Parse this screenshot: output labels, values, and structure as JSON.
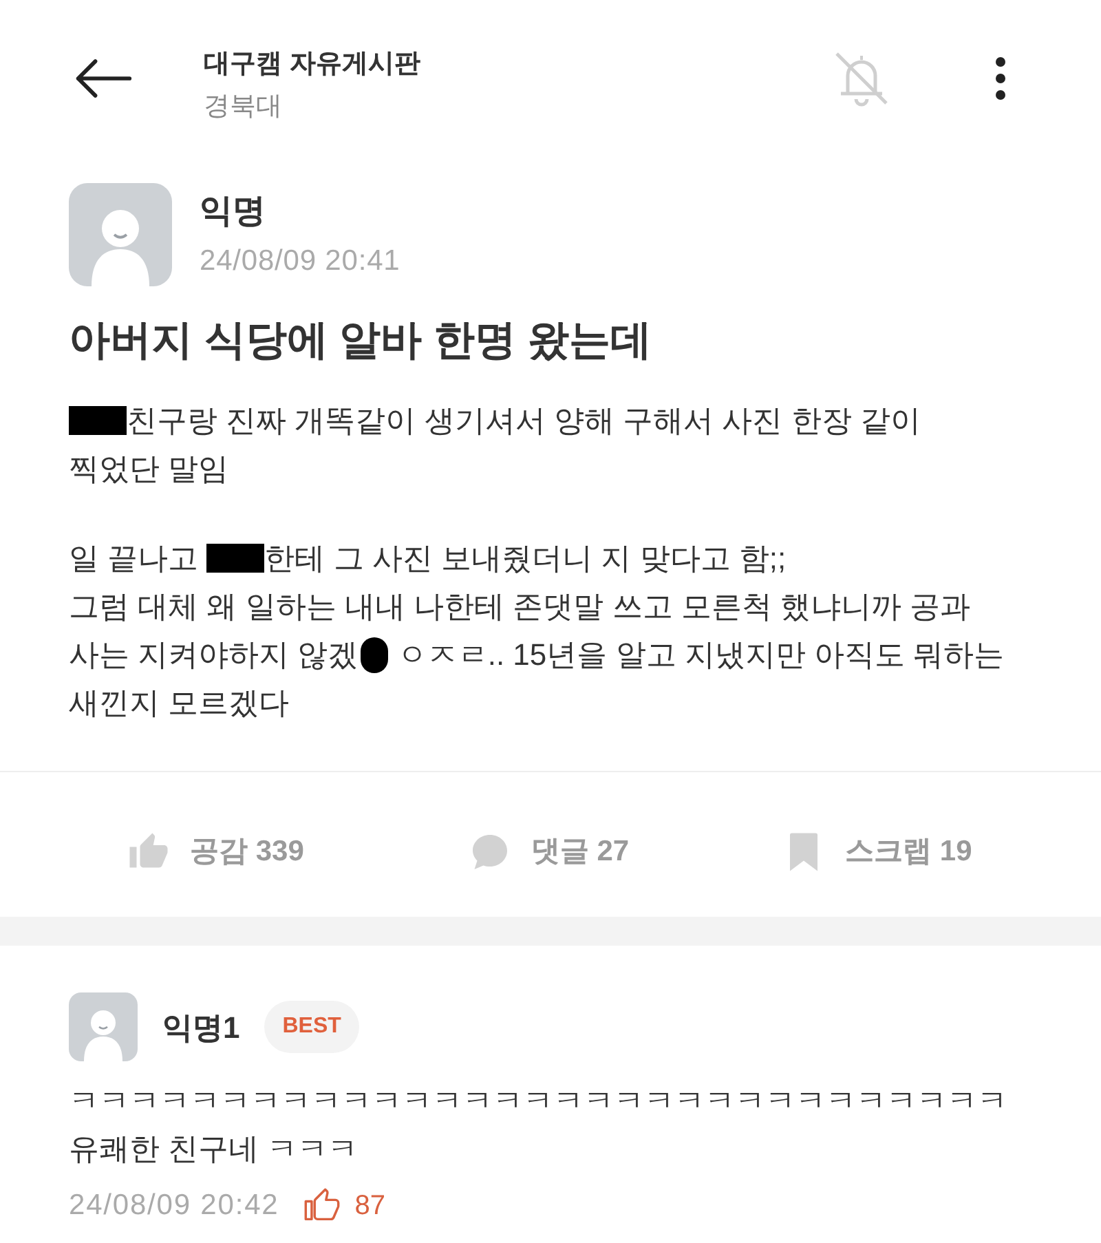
{
  "header": {
    "title": "대구캠 자유게시판",
    "subtitle": "경북대",
    "notifications_muted": true
  },
  "post": {
    "author": "익명",
    "time": "24/08/09 20:41",
    "title": "아버지 식당에 알바 한명 왔는데",
    "paragraphs": [
      {
        "lines": [
          {
            "segments": [
              {
                "kind": "redaction"
              },
              {
                "kind": "text",
                "text": "친구랑 진짜 개똑같이 생기셔서 양해 구해서 사진 한장 같이"
              }
            ]
          },
          {
            "segments": [
              {
                "kind": "text",
                "text": "찍었단 말임"
              }
            ]
          }
        ]
      },
      {
        "lines": [
          {
            "segments": [
              {
                "kind": "text",
                "text": "일 끝나고 "
              },
              {
                "kind": "redaction"
              },
              {
                "kind": "text",
                "text": "한테 그 사진 보내줬더니 지 맞다고 함;;"
              }
            ]
          },
          {
            "segments": [
              {
                "kind": "text",
                "text": "그럼 대체 왜 일하는 내내 나한테 존댓말 쓰고 모른척 했냐니까 공과"
              }
            ]
          },
          {
            "segments": [
              {
                "kind": "text",
                "text": "사는 지켜야하지 않겠"
              },
              {
                "kind": "smudge"
              },
              {
                "kind": "text",
                "text": " ㅇㅈㄹ.. 15년을 알고 지냈지만 아직도 뭐하는"
              }
            ]
          },
          {
            "segments": [
              {
                "kind": "text",
                "text": "새낀지 모르겠다"
              }
            ]
          }
        ]
      }
    ]
  },
  "actions": [
    {
      "kind": "like",
      "label": "공감 339"
    },
    {
      "kind": "comment",
      "label": "댓글 27"
    },
    {
      "kind": "scrap",
      "label": "스크랩 19"
    }
  ],
  "comments": [
    {
      "author": "익명1",
      "badge": "BEST",
      "text": "ㅋㅋㅋㅋㅋㅋㅋㅋㅋㅋㅋㅋㅋㅋㅋㅋㅋㅋㅋㅋㅋㅋㅋㅋㅋㅋㅋㅋㅋㅋㅋ\n유쾌한 친구네 ㅋㅋㅋ",
      "time": "24/08/09 20:42",
      "likes": "87"
    }
  ]
}
